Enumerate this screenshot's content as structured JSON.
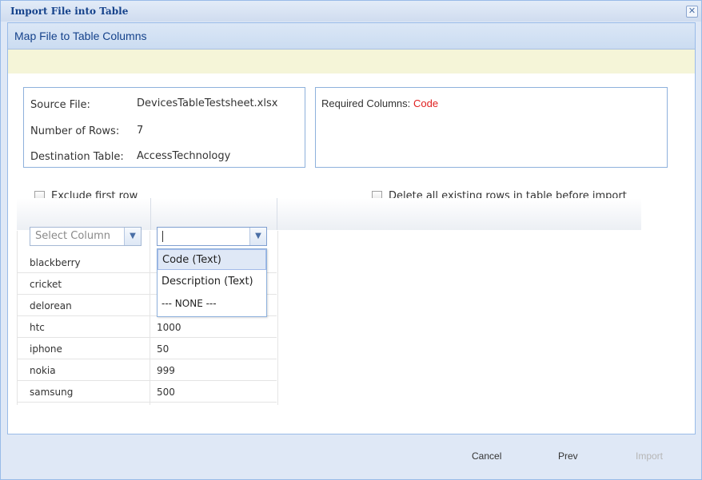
{
  "window": {
    "title": "Import File into Table"
  },
  "step": {
    "title": "Map File to Table Columns"
  },
  "info": {
    "source_label": "Source File:",
    "source_value": "DevicesTableTestsheet.xlsx",
    "rows_label": "Number of Rows:",
    "rows_value": "7",
    "dest_label": "Destination Table:",
    "dest_value": "AccessTechnology",
    "required_label": "Required Columns:",
    "required_value": "Code"
  },
  "options": {
    "exclude_first_row": "Exclude first row",
    "delete_existing": "Delete all existing rows in table before import"
  },
  "mapping": {
    "col1_placeholder": "Select Column",
    "col2_value": ""
  },
  "dropdown": {
    "items": [
      "Code (Text)",
      "Description (Text)",
      "--- NONE ---"
    ]
  },
  "grid": {
    "rows": [
      [
        "blackberry",
        ""
      ],
      [
        "cricket",
        ""
      ],
      [
        "delorean",
        ""
      ],
      [
        "htc",
        "1000"
      ],
      [
        "iphone",
        "50"
      ],
      [
        "nokia",
        "999"
      ],
      [
        "samsung",
        "500"
      ]
    ]
  },
  "footer": {
    "cancel": "Cancel",
    "prev": "Prev",
    "import": "Import"
  },
  "colors": {
    "required_value": "#e02020",
    "title": "#15428b",
    "message_bar": "#f5f5d8"
  },
  "icons": {
    "close": "close-icon",
    "trigger": "chevron-down-icon"
  }
}
